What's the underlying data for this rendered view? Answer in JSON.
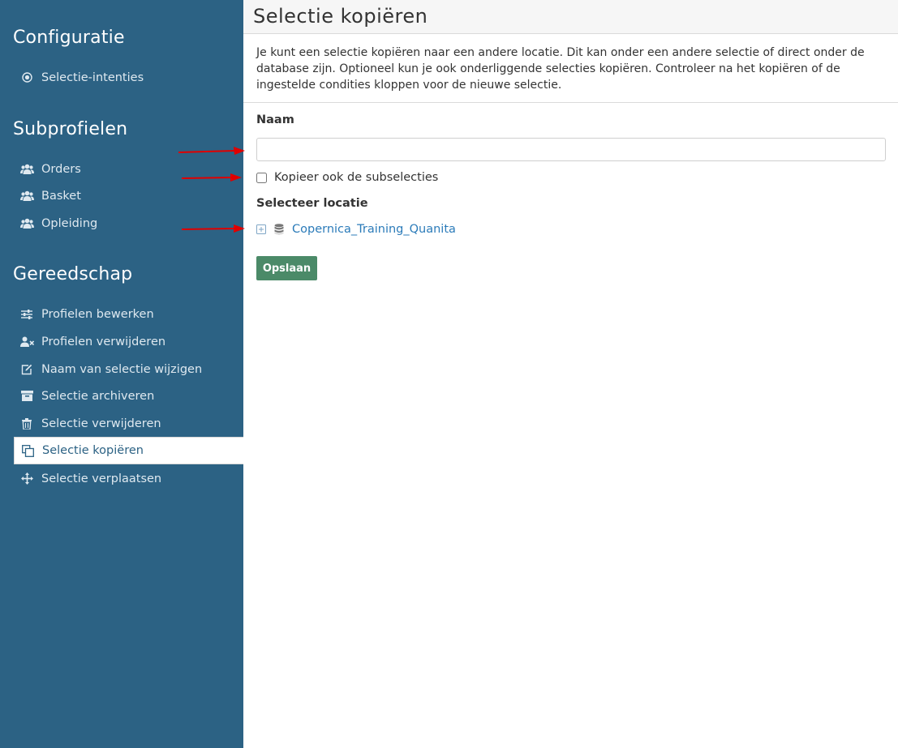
{
  "sidebar": {
    "sections": [
      {
        "title": "Configuratie",
        "items": [
          {
            "label": "Selectie-intenties",
            "icon": "target-icon"
          }
        ]
      },
      {
        "title": "Subprofielen",
        "items": [
          {
            "label": "Orders",
            "icon": "users-icon"
          },
          {
            "label": "Basket",
            "icon": "users-icon"
          },
          {
            "label": "Opleiding",
            "icon": "users-icon"
          }
        ]
      },
      {
        "title": "Gereedschap",
        "items": [
          {
            "label": "Profielen bewerken",
            "icon": "sliders-icon"
          },
          {
            "label": "Profielen verwijderen",
            "icon": "user-remove-icon"
          },
          {
            "label": "Naam van selectie wijzigen",
            "icon": "edit-icon"
          },
          {
            "label": "Selectie archiveren",
            "icon": "archive-icon"
          },
          {
            "label": "Selectie verwijderen",
            "icon": "trash-icon"
          },
          {
            "label": "Selectie kopiëren",
            "icon": "copy-icon",
            "active": true
          },
          {
            "label": "Selectie verplaatsen",
            "icon": "move-icon"
          }
        ]
      }
    ]
  },
  "main": {
    "title": "Selectie kopiëren",
    "intro": "Je kunt een selectie kopiëren naar een andere locatie. Dit kan onder een andere selectie of direct onder de database zijn. Optioneel kun je ook onderliggende selecties kopiëren. Controleer na het kopiëren of de ingestelde condities kloppen voor de nieuwe selectie.",
    "name_label": "Naam",
    "name_value": "",
    "copy_sub_label": "Kopieer ook de subselecties",
    "copy_sub_checked": false,
    "location_label": "Selecteer locatie",
    "tree_root": "Copernica_Training_Quanita",
    "save_label": "Opslaan"
  },
  "colors": {
    "sidebar_bg": "#2c6284",
    "save_button": "#4b8a68",
    "link": "#2b7bb9",
    "annotation_arrow": "#e00000"
  }
}
